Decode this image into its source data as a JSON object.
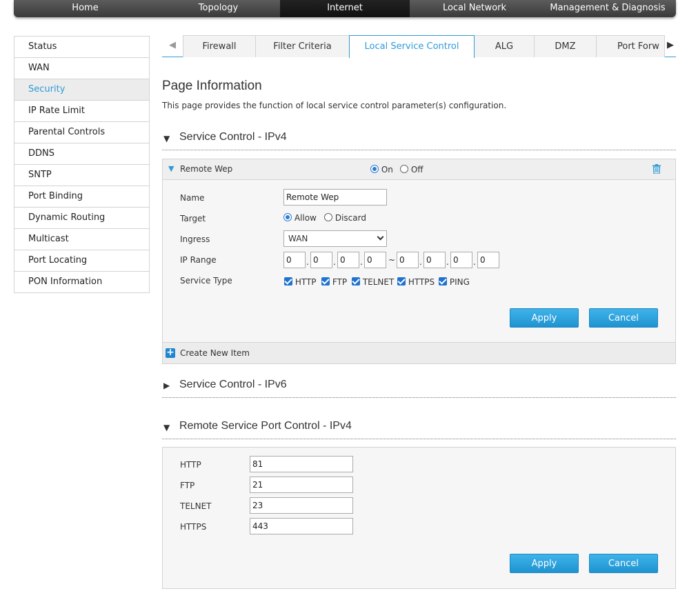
{
  "topnav": {
    "tabs": [
      {
        "label": "Home"
      },
      {
        "label": "Topology"
      },
      {
        "label": "Internet"
      },
      {
        "label": "Local Network"
      },
      {
        "label": "Management & Diagnosis"
      }
    ],
    "active_index": 2
  },
  "sidebar": {
    "items": [
      {
        "label": "Status"
      },
      {
        "label": "WAN"
      },
      {
        "label": "Security"
      },
      {
        "label": "IP Rate Limit"
      },
      {
        "label": "Parental Controls"
      },
      {
        "label": "DDNS"
      },
      {
        "label": "SNTP"
      },
      {
        "label": "Port Binding"
      },
      {
        "label": "Dynamic Routing"
      },
      {
        "label": "Multicast"
      },
      {
        "label": "Port Locating"
      },
      {
        "label": "PON Information"
      }
    ],
    "active": "Security"
  },
  "subtabs": {
    "tabs": [
      {
        "label": "Firewall"
      },
      {
        "label": "Filter Criteria"
      },
      {
        "label": "Local Service Control"
      },
      {
        "label": "ALG"
      },
      {
        "label": "DMZ"
      },
      {
        "label": "Port Forw"
      }
    ],
    "active": "Local Service Control"
  },
  "page": {
    "title": "Page Information",
    "description": "This page provides the function of local service control parameter(s) configuration."
  },
  "ipv4_section": {
    "title": "Service Control - IPv4",
    "entry": {
      "name": "Remote Wep",
      "state_on_label": "On",
      "state_off_label": "Off",
      "state": "On",
      "fields": {
        "name_label": "Name",
        "name_value": "Remote Wep",
        "target_label": "Target",
        "target_allow": "Allow",
        "target_discard": "Discard",
        "target_value": "Allow",
        "ingress_label": "Ingress",
        "ingress_value": "WAN",
        "ip_range_label": "IP Range",
        "ip_start": [
          "0",
          "0",
          "0",
          "0"
        ],
        "ip_end": [
          "0",
          "0",
          "0",
          "0"
        ],
        "range_sep": "~",
        "octet_sep": ".",
        "service_type_label": "Service Type",
        "services": [
          "HTTP",
          "FTP",
          "TELNET",
          "HTTPS",
          "PING"
        ]
      },
      "apply_label": "Apply",
      "cancel_label": "Cancel"
    },
    "create_new_label": "Create New Item"
  },
  "ipv6_section": {
    "title": "Service Control - IPv6"
  },
  "port_section": {
    "title": "Remote Service Port Control - IPv4",
    "ports": [
      {
        "label": "HTTP",
        "value": "81"
      },
      {
        "label": "FTP",
        "value": "21"
      },
      {
        "label": "TELNET",
        "value": "23"
      },
      {
        "label": "HTTPS",
        "value": "443"
      }
    ],
    "apply_label": "Apply",
    "cancel_label": "Cancel"
  },
  "colors": {
    "accent": "#2e9bd8",
    "button": "#1e93d0",
    "topnav": "#3a3a3a"
  },
  "icons": {
    "expand": "triangle-down",
    "collapse": "triangle-right",
    "delete": "trash-icon",
    "add": "plus-icon",
    "scroll_left": "arrow-left",
    "scroll_right": "arrow-right"
  }
}
